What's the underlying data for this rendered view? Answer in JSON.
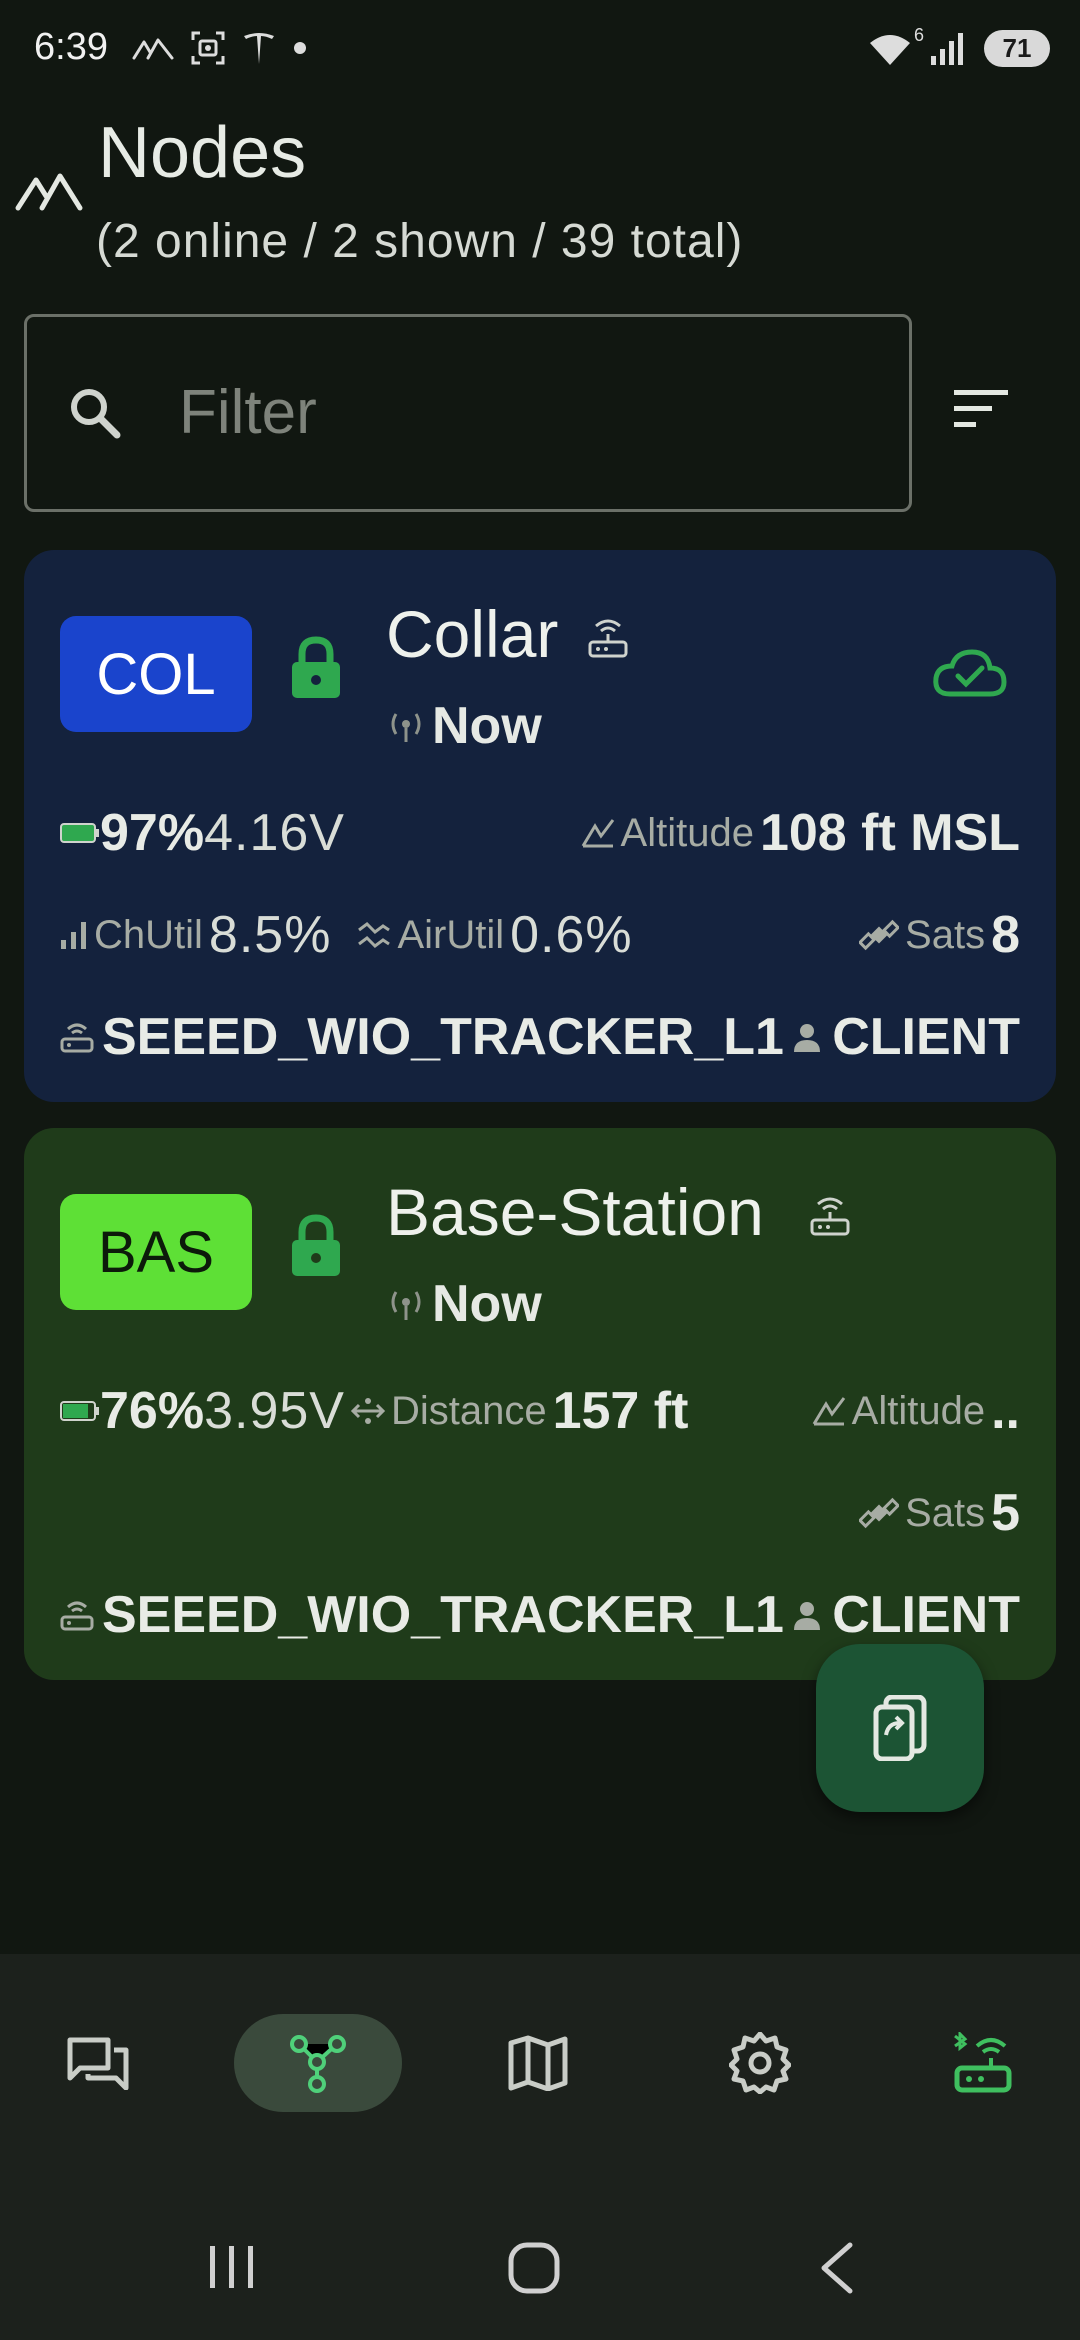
{
  "status_bar": {
    "time": "6:39",
    "battery": "71",
    "wifi_label": "6",
    "left_icons": [
      "meshtastic-icon",
      "screenshot-icon",
      "tesla-icon",
      "dot-icon"
    ],
    "right_icons": [
      "wifi-icon",
      "cell-signal-icon",
      "battery-icon"
    ]
  },
  "header": {
    "title": "Nodes",
    "subtitle": "(2 online / 2 shown / 39 total)"
  },
  "filter": {
    "placeholder": "Filter",
    "value": ""
  },
  "nodes": [
    {
      "short": "COL",
      "name": "Collar",
      "last_heard": "Now",
      "battery": "97%",
      "voltage": "4.16V",
      "altitude_label": "Altitude",
      "altitude": "108 ft MSL",
      "chutil_label": "ChUtil",
      "chutil": "8.5%",
      "airutil_label": "AirUtil",
      "airutil": "0.6%",
      "sats_label": "Sats",
      "sats": "8",
      "hardware": "SEEED_WIO_TRACKER_L1",
      "role": "CLIENT",
      "colors": {
        "card": "#14223d",
        "badge": "#1a44cc"
      }
    },
    {
      "short": "BAS",
      "name": "Base-Station",
      "last_heard": "Now",
      "battery": "76%",
      "voltage": "3.95V",
      "distance_label": "Distance",
      "distance": "157 ft",
      "altitude_label": "Altitude",
      "altitude_trunc": "..",
      "sats_label": "Sats",
      "sats": "5",
      "hardware": "SEEED_WIO_TRACKER_L1",
      "role": "CLIENT",
      "colors": {
        "card": "#1f3b1a",
        "badge": "#5ee036"
      }
    }
  ],
  "bottom_nav": {
    "items": [
      "chat-icon",
      "nodes-icon",
      "map-icon",
      "settings-icon",
      "connection-icon"
    ],
    "selected": "nodes-icon"
  },
  "colors": {
    "background": "#111711",
    "accent_green": "#2fa84f",
    "nav_selected": "#3a4a3c"
  }
}
